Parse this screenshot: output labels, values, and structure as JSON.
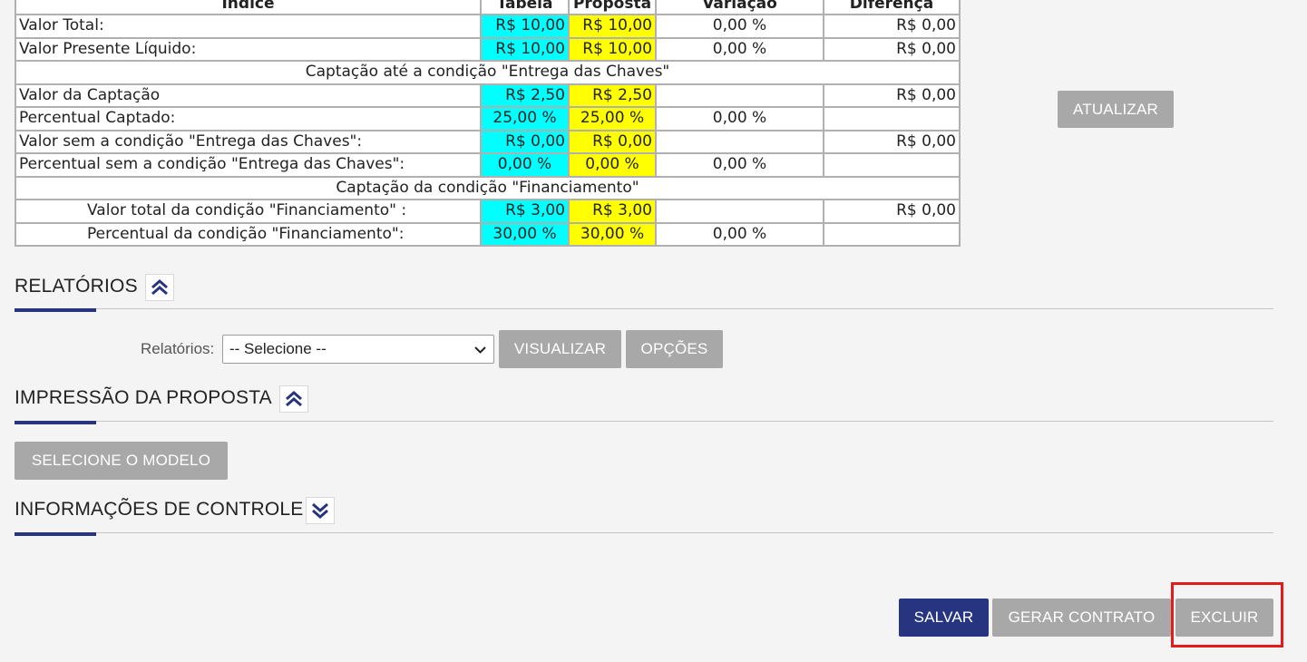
{
  "table": {
    "header": [
      "Índice",
      "Tabela",
      "Proposta",
      "Variação",
      "Diferença"
    ],
    "rows": [
      {
        "label": "Valor Total:",
        "tabela": "R$  10,00",
        "proposta": "R$  10,00",
        "variacao": "0,00 %",
        "diferenca": "R$  0,00"
      },
      {
        "label": "Valor Presente Líquido:",
        "tabela": "R$  10,00",
        "proposta": "R$  10,00",
        "variacao": "0,00 %",
        "diferenca": "R$  0,00"
      }
    ],
    "section1_title": "Captação até a condição \"Entrega das Chaves\"",
    "section1_rows": [
      {
        "label": "Valor da Captação",
        "tabela": "R$  2,50",
        "proposta": "R$  2,50",
        "variacao": "",
        "diferenca": "R$  0,00"
      },
      {
        "label": "Percentual Captado:",
        "tabela": "25,00 %",
        "proposta": "25,00 %",
        "variacao": "0,00 %",
        "diferenca": ""
      },
      {
        "label": "Valor sem a condição \"Entrega das Chaves\":",
        "tabela": "R$  0,00",
        "proposta": "R$  0,00",
        "variacao": "",
        "diferenca": "R$  0,00"
      },
      {
        "label": "Percentual sem a condição \"Entrega das Chaves\":",
        "tabela": "0,00 %",
        "proposta": "0,00 %",
        "variacao": "0,00 %",
        "diferenca": ""
      }
    ],
    "section2_title": "Captação da condição \"Financiamento\"",
    "section2_rows": [
      {
        "label": "Valor total da condição \"Financiamento\" :",
        "tabela": "R$  3,00",
        "proposta": "R$  3,00",
        "variacao": "",
        "diferenca": "R$  0,00"
      },
      {
        "label": "Percentual da condição \"Financiamento\":",
        "tabela": "30,00 %",
        "proposta": "30,00 %",
        "variacao": "0,00 %",
        "diferenca": ""
      }
    ]
  },
  "buttons": {
    "atualizar": "ATUALIZAR",
    "visualizar": "VISUALIZAR",
    "opcoes": "OPÇÕES",
    "selecione_modelo": "SELECIONE O MODELO",
    "salvar": "SALVAR",
    "gerar_contrato": "GERAR CONTRATO",
    "excluir": "EXCLUIR"
  },
  "sections": {
    "relatorios": "RELATÓRIOS",
    "impressao": "IMPRESSÃO DA PROPOSTA",
    "controle": "INFORMAÇÕES DE CONTROLE"
  },
  "relatorios_form": {
    "label": "Relatórios:",
    "selected": "-- Selecione --"
  },
  "colors": {
    "accent": "#273480",
    "button_gray": "#a8a8a8",
    "cyan_cell": "#00ffff",
    "yellow_cell": "#ffff00",
    "highlight": "#e41b1b"
  },
  "icons": {
    "relatorios_toggle": "chevron-double-up-icon",
    "impressao_toggle": "chevron-double-up-icon",
    "controle_toggle": "chevron-double-down-icon",
    "select_arrow": "chevron-down-icon"
  }
}
